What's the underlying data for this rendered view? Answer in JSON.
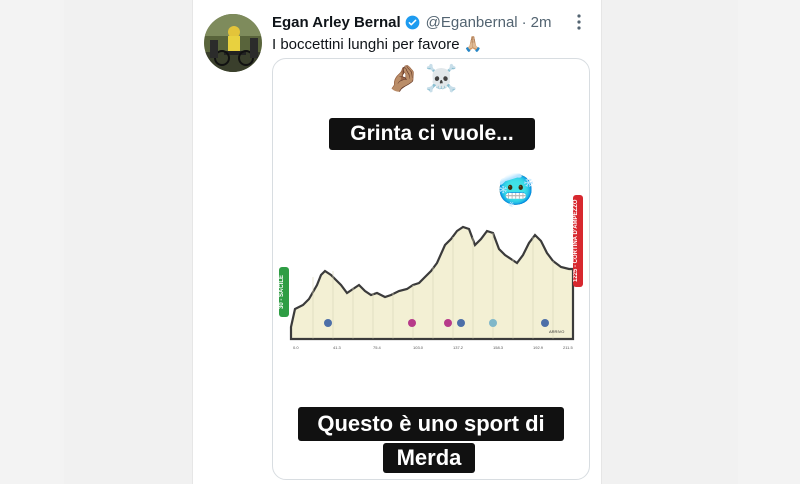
{
  "tweet": {
    "author_name": "Egan Arley Bernal",
    "handle": "@Eganbernal",
    "separator": "·",
    "time": "2m",
    "text": "I boccettini lunghi per favore 🙏🏼"
  },
  "media": {
    "top_emojis": [
      "🤌🏽",
      "☠️"
    ],
    "caption_top": "Grinta ci vuole...",
    "caption_bottom_line1": "Questo è uno sport di",
    "caption_bottom_line2": "Merda",
    "sticker_emoji": "🥶",
    "profile": {
      "start_label": "30 - SACILE",
      "finish_label": "1225 - CORTINA D'AMPEZZO",
      "climb_labels": [
        "1118 - LA CROSETTA",
        "2057 - PASSO FEDAIA",
        "2239 - PASSO PORDOI",
        "2233 - PASSO GIAU"
      ],
      "end_label": "ARRIVO"
    }
  },
  "colors": {
    "profile_fill": "#f3f0d4",
    "profile_stroke": "#3b3b3b",
    "start_badge": "#2e9d44",
    "finish_badge": "#d7282f",
    "verified": "#1d9bf0"
  }
}
